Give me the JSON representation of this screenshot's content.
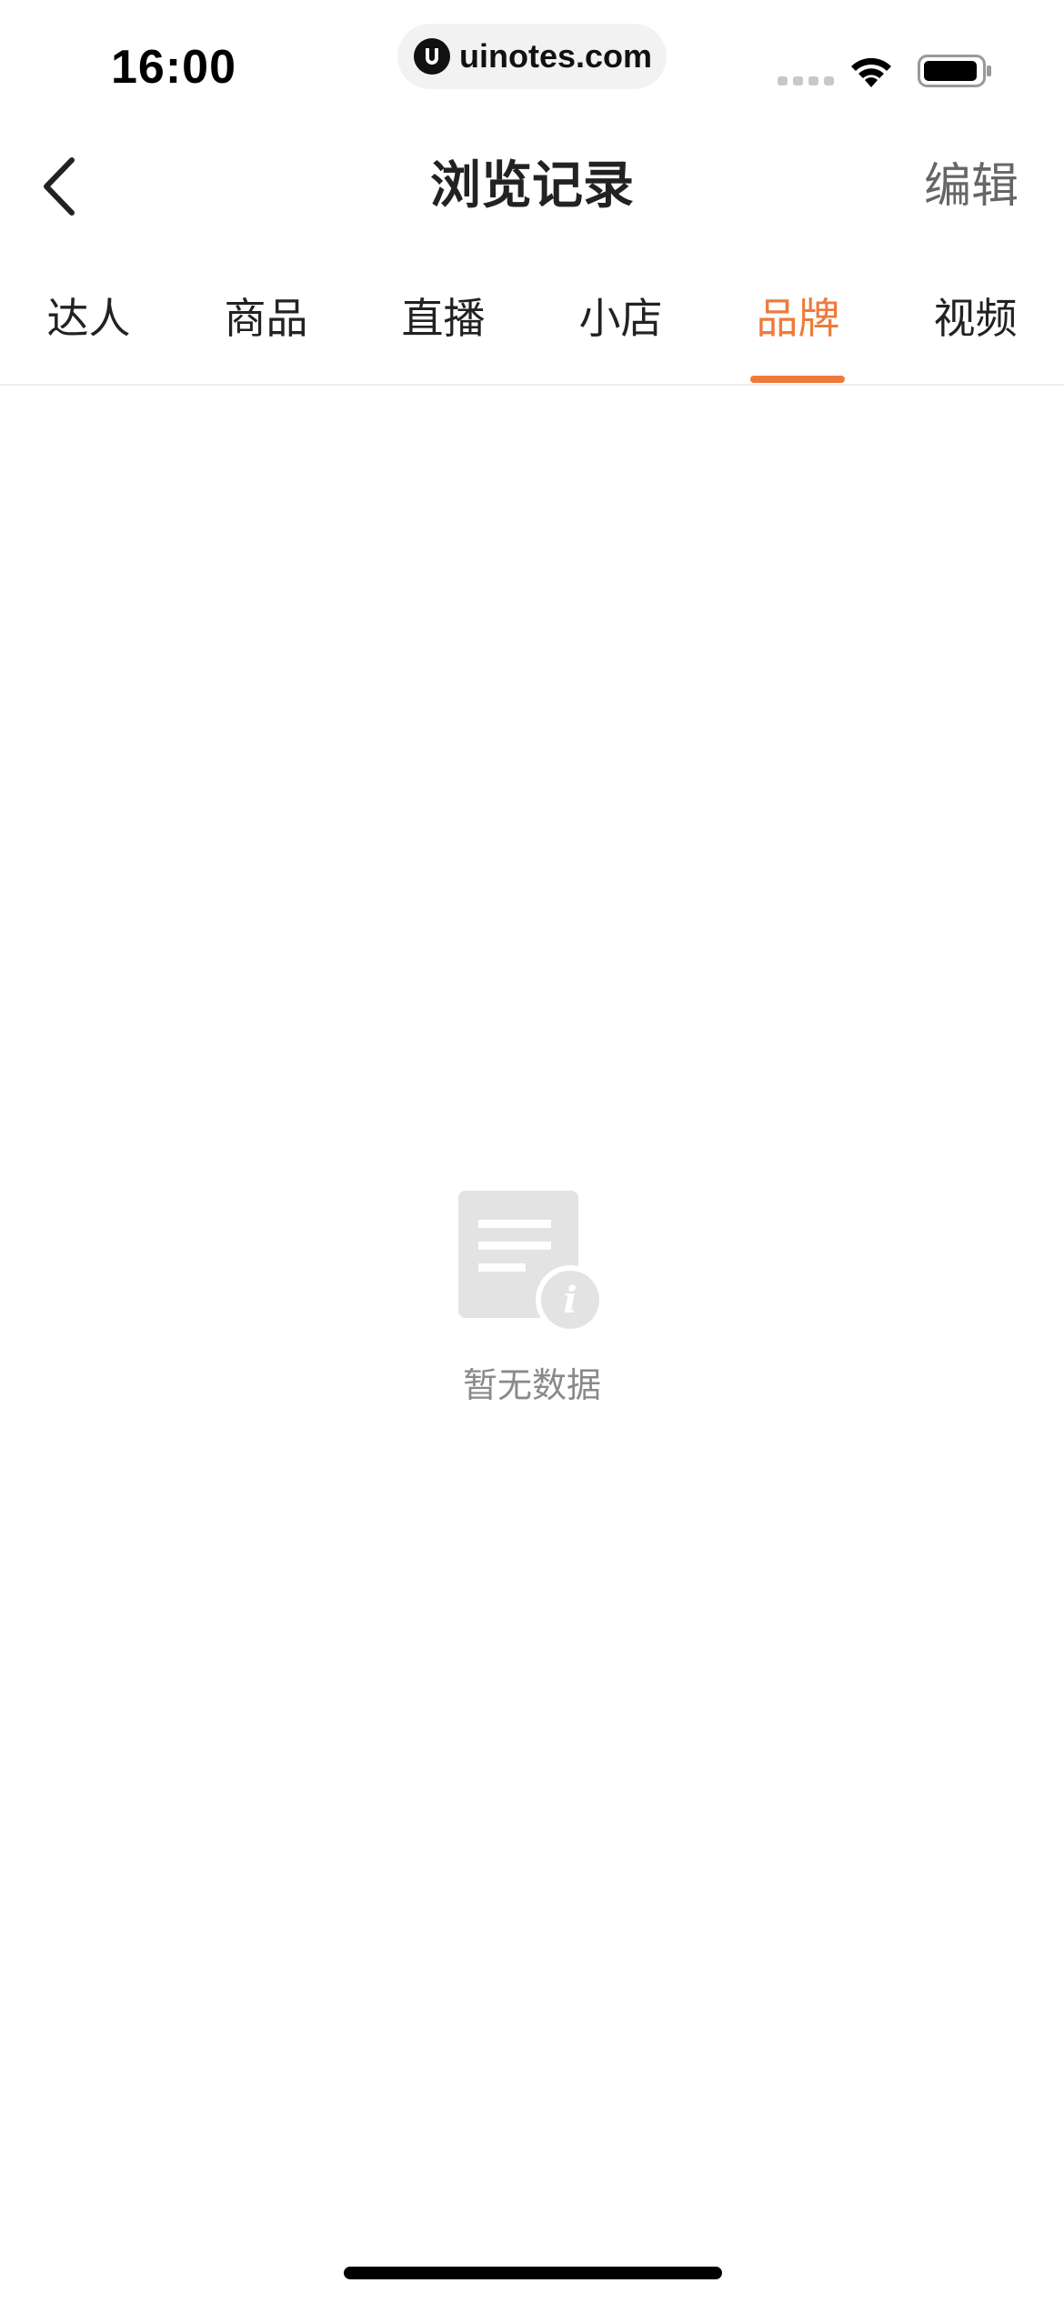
{
  "status_bar": {
    "time": "16:00",
    "url": "uinotes.com"
  },
  "nav": {
    "title": "浏览记录",
    "edit_label": "编辑",
    "back_icon": "chevron-left-icon"
  },
  "tabs": [
    {
      "label": "达人",
      "active": false
    },
    {
      "label": "商品",
      "active": false
    },
    {
      "label": "直播",
      "active": false
    },
    {
      "label": "小店",
      "active": false
    },
    {
      "label": "品牌",
      "active": true
    },
    {
      "label": "视频",
      "active": false
    }
  ],
  "empty_state": {
    "message": "暂无数据",
    "icon": "empty-document-info-icon"
  },
  "colors": {
    "accent": "#ee7b3b",
    "text": "#222222",
    "muted": "#8a8a8a",
    "placeholder_icon": "#e0e0e0"
  }
}
